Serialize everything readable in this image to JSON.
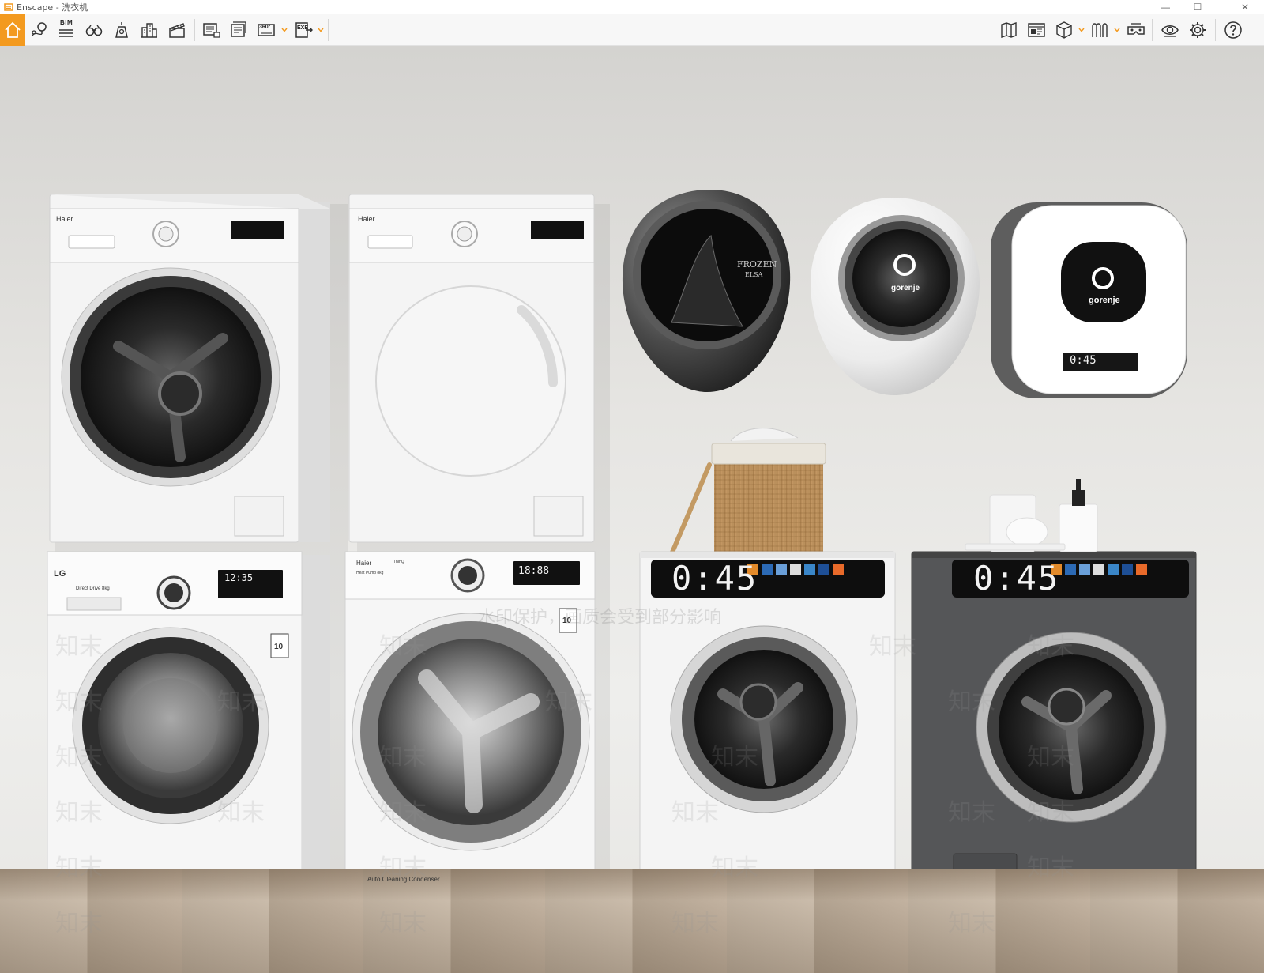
{
  "window": {
    "title": "Enscape - 洗衣机",
    "minimize_glyph": "—",
    "maximize_glyph": "☐",
    "close_glyph": "✕"
  },
  "toolbar": {
    "accent": "#f39a1f",
    "bim_label": "BIM",
    "panorama_label": "360°",
    "exe_label": "EXE",
    "left_tools": [
      "home-icon",
      "location-pin-icon",
      "bim-list-icon",
      "binoculars-icon",
      "asset-library-icon",
      "buildings-icon",
      "clapper-icon",
      "render-image-icon",
      "batch-render-icon",
      "panorama-icon",
      "export-exe-icon"
    ],
    "right_tools": [
      "map-icon",
      "info-panel-icon",
      "cube-view-icon",
      "visual-presets-icon",
      "vr-headset-icon",
      "eye-icon",
      "settings-gear-icon",
      "help-icon"
    ]
  },
  "scene": {
    "washer1": {
      "brand": "Haier",
      "lower_brand": "LG",
      "tagline": "Direct Drive 8kg",
      "display": "12:35",
      "badge": "10"
    },
    "washer2": {
      "brand": "Haier",
      "lower_brand": "Haier",
      "tagline": "Heat Pump 8kg",
      "display": "18:88",
      "condenser": "Auto Cleaning Condenser",
      "badge": "10",
      "thing_label": "ThinQ"
    },
    "wall_units": [
      {
        "name": "frozen",
        "text1": "FROZEN",
        "text2": "ELSA"
      },
      {
        "name": "gorenje-egg",
        "brand": "gorenje"
      },
      {
        "name": "gorenje-square",
        "brand": "gorenje",
        "display": "0:45"
      }
    ],
    "front_loaders": [
      {
        "color": "white",
        "display": "0:45"
      },
      {
        "color": "graphite",
        "display": "0:45"
      }
    ],
    "watermark": {
      "banner": "水印保护，画质会受到部分影响",
      "tile": "知末"
    }
  }
}
